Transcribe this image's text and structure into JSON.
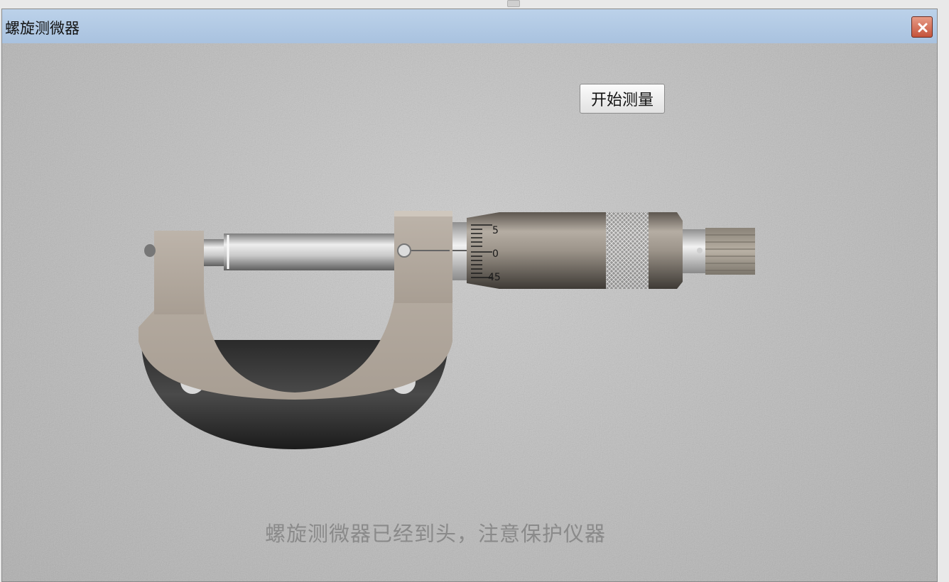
{
  "window": {
    "title": "螺旋测微器",
    "close_icon": "close-icon"
  },
  "toolbar": {
    "start_label": "开始测量"
  },
  "status": {
    "message": "螺旋测微器已经到头，注意保护仪器"
  },
  "micrometer": {
    "thimble_scale_labels": [
      "5",
      "0",
      "45"
    ],
    "icons": [
      "micrometer-frame",
      "micrometer-spindle",
      "micrometer-thimble",
      "micrometer-ratchet"
    ]
  },
  "colors": {
    "titlebar": "#bcd2ea",
    "close_button": "#c4533b",
    "background": "#bdbdbd"
  }
}
